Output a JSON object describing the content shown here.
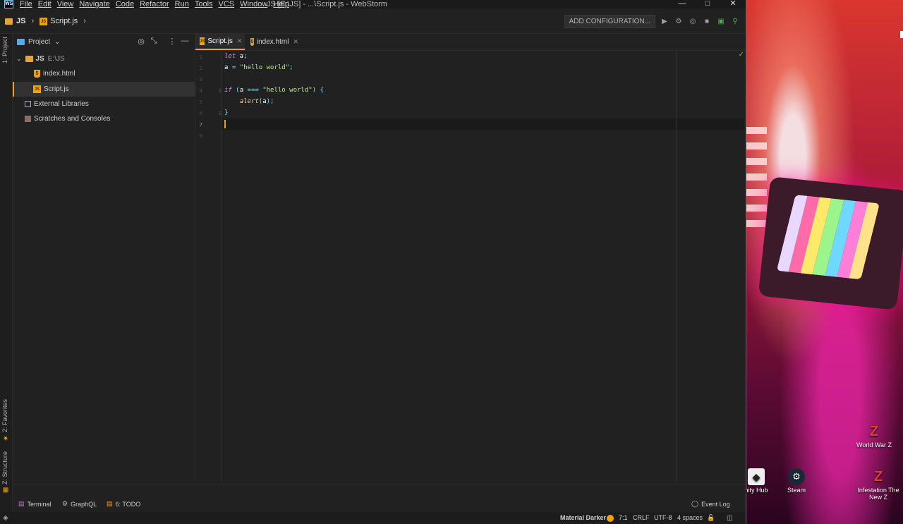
{
  "titlebar": {
    "menu": [
      "File",
      "Edit",
      "View",
      "Navigate",
      "Code",
      "Refactor",
      "Run",
      "Tools",
      "VCS",
      "Window",
      "Help"
    ],
    "title": "JS [E:\\JS] - ...\\Script.js - WebStorm"
  },
  "navbar": {
    "crumb_project": "JS",
    "crumb_file": "Script.js",
    "add_configuration": "ADD CONFIGURATION..."
  },
  "stripe": {
    "project": "1: Project",
    "favorites": "2: Favorites",
    "structure": "Z: Structure"
  },
  "project_panel": {
    "title": "Project",
    "root": "JS",
    "root_path": "E:\\JS",
    "files": [
      "index.html",
      "Script.js"
    ],
    "external_libraries": "External Libraries",
    "scratches": "Scratches and Consoles"
  },
  "tabs": [
    {
      "label": "Script.js",
      "active": true
    },
    {
      "label": "index.html",
      "active": false
    }
  ],
  "editor": {
    "line_numbers": [
      "1",
      "2",
      "3",
      "4",
      "5",
      "6",
      "7",
      "8"
    ],
    "cursor_line": 7
  },
  "bottom_tools": {
    "terminal": "Terminal",
    "graphql": "GraphQL",
    "todo": "6: TODO",
    "event_log": "Event Log"
  },
  "status": {
    "theme": "Material Darker",
    "position": "7:1",
    "line_sep": "CRLF",
    "encoding": "UTF-8",
    "indent": "4 spaces"
  },
  "desktop": {
    "icons": [
      "World War Z",
      "nity Hub",
      "Steam",
      "Infestation The New Z"
    ]
  },
  "colors": {
    "accent": "#f0a30a",
    "background": "#212121",
    "keyword": "#c792ea",
    "string": "#c3e88d",
    "function": "#ffcb6b"
  }
}
